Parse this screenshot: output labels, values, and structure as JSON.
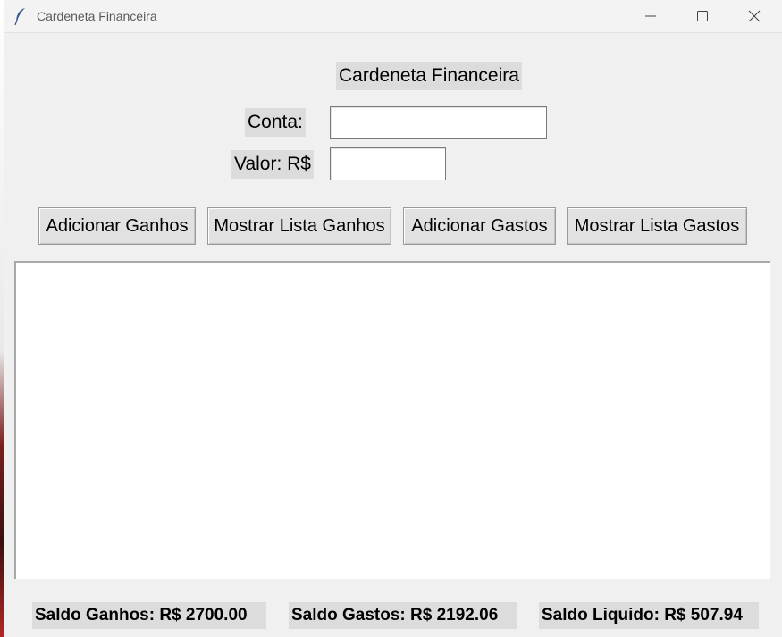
{
  "window": {
    "title": "Cardeneta Financeira",
    "icon": "feather-icon"
  },
  "header": {
    "title": "Cardeneta Financeira"
  },
  "form": {
    "conta_label": "Conta:",
    "conta_value": "",
    "valor_label": "Valor: R$",
    "valor_value": ""
  },
  "buttons": {
    "add_income": "Adicionar Ganhos",
    "show_income": "Mostrar Lista Ganhos",
    "add_expense": "Adicionar Gastos",
    "show_expense": "Mostrar Lista Gastos"
  },
  "list": {
    "items": []
  },
  "footer": {
    "saldo_ganhos": "Saldo Ganhos: R$ 2700.00",
    "saldo_gastos": "Saldo Gastos: R$ 2192.06",
    "saldo_liquido": "Saldo Liquido: R$ 507.94"
  }
}
